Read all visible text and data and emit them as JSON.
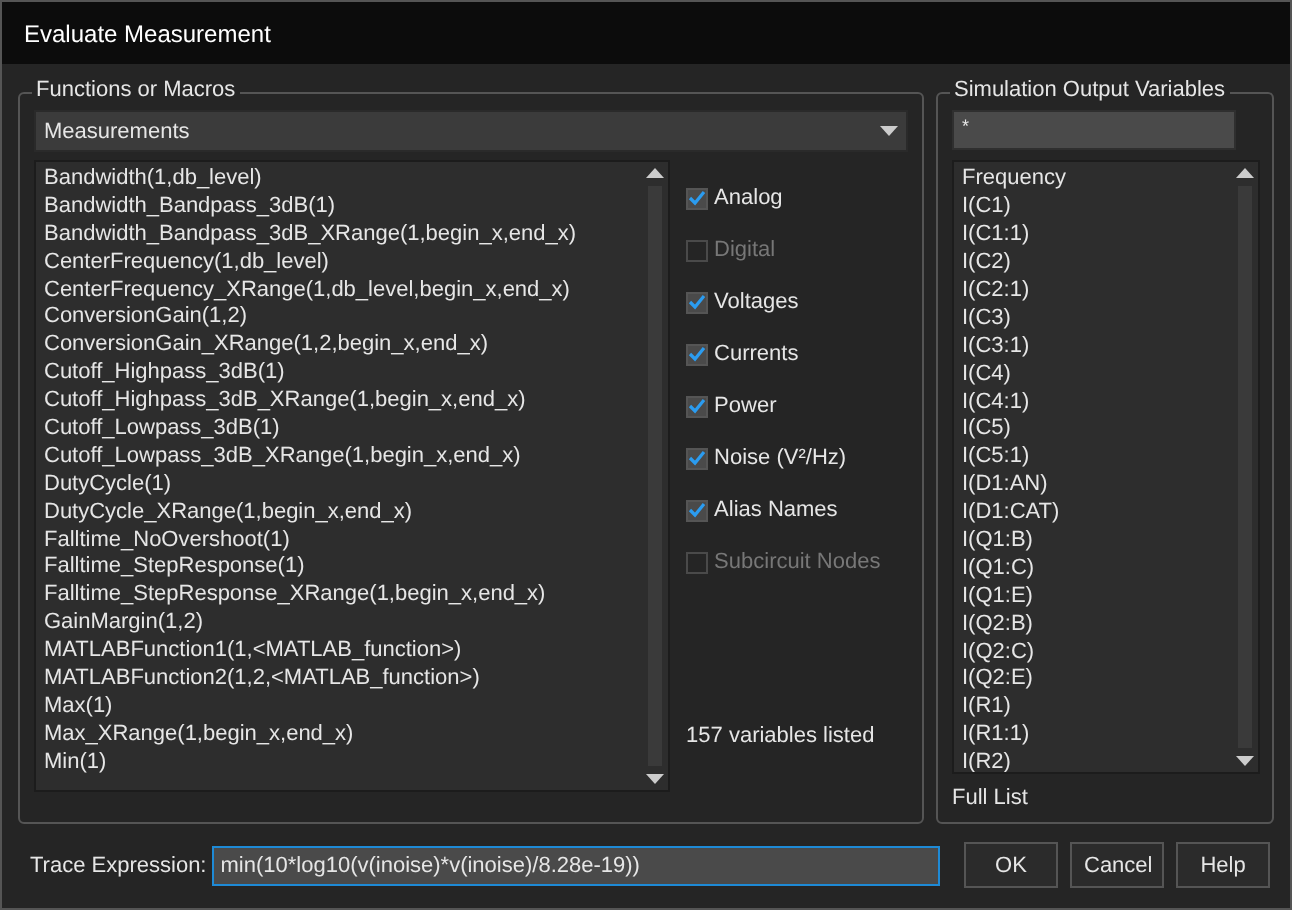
{
  "window": {
    "title": "Evaluate Measurement"
  },
  "functions": {
    "label": "Functions or Macros",
    "category": "Measurements",
    "items": [
      {
        "text": "Bandwidth(1,db_level)",
        "selected": false
      },
      {
        "text": "Bandwidth_Bandpass_3dB(1)",
        "selected": false
      },
      {
        "text": "Bandwidth_Bandpass_3dB_XRange(1,begin_x,end_x)",
        "selected": false
      },
      {
        "text": "CenterFrequency(1,db_level)",
        "selected": false
      },
      {
        "text": "CenterFrequency_XRange(1,db_level,begin_x,end_x)",
        "selected": false
      },
      {
        "text": "ConversionGain(1,2)",
        "selected": false
      },
      {
        "text": "ConversionGain_XRange(1,2,begin_x,end_x)",
        "selected": false
      },
      {
        "text": "Cutoff_Highpass_3dB(1)",
        "selected": false
      },
      {
        "text": "Cutoff_Highpass_3dB_XRange(1,begin_x,end_x)",
        "selected": false
      },
      {
        "text": "Cutoff_Lowpass_3dB(1)",
        "selected": false
      },
      {
        "text": "Cutoff_Lowpass_3dB_XRange(1,begin_x,end_x)",
        "selected": false
      },
      {
        "text": "DutyCycle(1)",
        "selected": false
      },
      {
        "text": "DutyCycle_XRange(1,begin_x,end_x)",
        "selected": false
      },
      {
        "text": "Falltime_NoOvershoot(1)",
        "selected": false
      },
      {
        "text": "Falltime_StepResponse(1)",
        "selected": false
      },
      {
        "text": "Falltime_StepResponse_XRange(1,begin_x,end_x)",
        "selected": false
      },
      {
        "text": "GainMargin(1,2)",
        "selected": false
      },
      {
        "text": "MATLABFunction1(1,<MATLAB_function>)",
        "selected": false
      },
      {
        "text": "MATLABFunction2(1,2,<MATLAB_function>)",
        "selected": false
      },
      {
        "text": "Max(1)",
        "selected": false
      },
      {
        "text": "Max_XRange(1,begin_x,end_x)",
        "selected": false
      },
      {
        "text": "Min(1)",
        "selected": false
      }
    ]
  },
  "filters": [
    {
      "label": "Analog",
      "checked": true,
      "disabled": false
    },
    {
      "label": "Digital",
      "checked": false,
      "disabled": true
    },
    {
      "label": "Voltages",
      "checked": true,
      "disabled": false
    },
    {
      "label": "Currents",
      "checked": true,
      "disabled": false
    },
    {
      "label": "Power",
      "checked": true,
      "disabled": false
    },
    {
      "label": "Noise (V²/Hz)",
      "checked": true,
      "disabled": false
    },
    {
      "label": "Alias Names",
      "checked": true,
      "disabled": false
    },
    {
      "label": "Subcircuit Nodes",
      "checked": false,
      "disabled": true
    }
  ],
  "count": "157 variables listed",
  "variables": {
    "label": "Simulation Output Variables",
    "filter": "*",
    "items": [
      {
        "text": "Frequency",
        "selected": false
      },
      {
        "text": "I(C1)",
        "selected": false
      },
      {
        "text": "I(C1:1)",
        "selected": false
      },
      {
        "text": "I(C2)",
        "selected": false
      },
      {
        "text": "I(C2:1)",
        "selected": false
      },
      {
        "text": "I(C3)",
        "selected": false
      },
      {
        "text": "I(C3:1)",
        "selected": false
      },
      {
        "text": "I(C4)",
        "selected": false
      },
      {
        "text": "I(C4:1)",
        "selected": false
      },
      {
        "text": "I(C5)",
        "selected": false
      },
      {
        "text": "I(C5:1)",
        "selected": false
      },
      {
        "text": "I(D1:AN)",
        "selected": false
      },
      {
        "text": "I(D1:CAT)",
        "selected": false
      },
      {
        "text": "I(Q1:B)",
        "selected": false
      },
      {
        "text": "I(Q1:C)",
        "selected": false
      },
      {
        "text": "I(Q1:E)",
        "selected": false
      },
      {
        "text": "I(Q2:B)",
        "selected": false
      },
      {
        "text": "I(Q2:C)",
        "selected": false
      },
      {
        "text": "I(Q2:E)",
        "selected": false
      },
      {
        "text": "I(R1)",
        "selected": false
      },
      {
        "text": "I(R1:1)",
        "selected": false
      },
      {
        "text": "I(R2)",
        "selected": false
      }
    ],
    "footer": "Full List"
  },
  "trace": {
    "label": "Trace Expression:",
    "value": "min(10*log10(v(inoise)*v(inoise)/8.28e-19))"
  },
  "buttons": [
    "OK",
    "Cancel",
    "Help"
  ]
}
